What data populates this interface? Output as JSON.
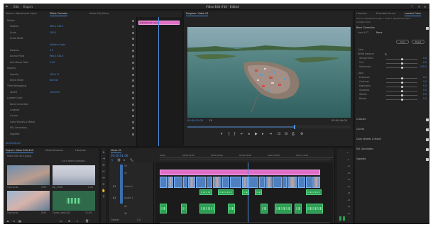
{
  "app": {
    "menu": [
      "Edit",
      "Export"
    ],
    "window_title": "Video Edit #10 - Edited"
  },
  "source_panel": {
    "tabs": [
      "Source: Adjustment Layer",
      "Effect Controls",
      "Audio Clip Mixer"
    ],
    "clip_label": "Adjustment Layer",
    "rows": [
      {
        "label": "Motion",
        "value": ""
      },
      {
        "label": "Position",
        "value": "960.0   540.0"
      },
      {
        "label": "Scale",
        "value": "100.0"
      },
      {
        "label": "Scale Width",
        "value": ""
      },
      {
        "label": "",
        "value": "Uniform Scale"
      },
      {
        "label": "Rotation",
        "value": "0.0"
      },
      {
        "label": "Anchor Point",
        "value": "960.0   540.0"
      },
      {
        "label": "Anti-flicker Filter",
        "value": "0.00"
      },
      {
        "label": "Opacity",
        "value": ""
      },
      {
        "label": "Opacity",
        "value": "100.0 %"
      },
      {
        "label": "Blend Mode",
        "value": "Normal"
      },
      {
        "label": "Time Remapping",
        "value": ""
      },
      {
        "label": "Speed",
        "value": "100.00%"
      },
      {
        "label": "Lumetri Color",
        "value": ""
      },
      {
        "label": "Basic Correction",
        "value": ""
      },
      {
        "label": "Creative",
        "value": ""
      },
      {
        "label": "Curves",
        "value": ""
      },
      {
        "label": "Color Wheels & Match",
        "value": ""
      },
      {
        "label": "HSL Secondary",
        "value": ""
      },
      {
        "label": "Vignette",
        "value": ""
      }
    ],
    "timecode": "00:00:00:00",
    "mini_clip_label": "Adjustment Layer"
  },
  "program_panel": {
    "tab": "Program: Video 01",
    "timecode": "00:00:01:00",
    "fit": "Fit",
    "duration": "00:00:44:00",
    "controls": [
      "marker",
      "in",
      "out",
      "go-in",
      "step-back",
      "play",
      "step-forward",
      "go-out",
      "insert",
      "overwrite",
      "export-frame",
      "camera",
      "more"
    ]
  },
  "lumetri_panel": {
    "tabs": [
      "Libraries",
      "Essential Sound",
      "Lumetri Color"
    ],
    "header": "Source: Adjustment Layer  >  Video 1 Adjustment Layer",
    "sub": "Lumetri Color",
    "section": "Basic Correction",
    "input_lut_label": "Input LUT",
    "input_lut_value": "None",
    "buttons": [
      "Auto",
      "Reset"
    ],
    "color_label": "Color",
    "white_balance": "White Balance",
    "temp_rows": [
      {
        "label": "Temperature",
        "value": "0.0",
        "pos": 0.5
      },
      {
        "label": "Tint",
        "value": "0.0",
        "pos": 0.5
      },
      {
        "label": "Saturation",
        "value": "100.0",
        "pos": 0.5
      }
    ],
    "light_label": "Light",
    "light_rows": [
      {
        "label": "Exposure",
        "value": "0.0",
        "pos": 0.5
      },
      {
        "label": "Contrast",
        "value": "0.0",
        "pos": 0.5
      },
      {
        "label": "Highlights",
        "value": "0.0",
        "pos": 0.5
      },
      {
        "label": "Shadows",
        "value": "0.0",
        "pos": 0.5
      },
      {
        "label": "Whites",
        "value": "0.0",
        "pos": 0.5
      },
      {
        "label": "Blacks",
        "value": "0.0",
        "pos": 0.5
      }
    ],
    "sections": [
      "Creative",
      "Curves",
      "Color Wheels & Match",
      "HSL Secondary",
      "Vignette"
    ]
  },
  "project_panel": {
    "tabs": [
      "Project: Video Edit #10",
      "Media Browser",
      "Libraries"
    ],
    "file": "Video Edit #10.prproj",
    "count": "1 of 6 items selected",
    "items": [
      {
        "name": "Overlords",
        "duration": "5:00"
      },
      {
        "name": "DJI_0398",
        "duration": "0:00"
      },
      {
        "name": "Overlords",
        "duration": "0:00"
      },
      {
        "name": "Ocean_edit_001",
        "duration": "21:09"
      }
    ]
  },
  "timeline": {
    "tab": "Video 01",
    "timecode": "00:00:01:00",
    "ruler": [
      "00:00",
      "00:00:15:00",
      "00:00:30:00",
      "00:00:45:00",
      "00:01:00:00",
      "00:01:15:00",
      "00:01:30:00"
    ],
    "video_tracks": [
      "V3",
      "V2",
      "V1"
    ],
    "audio_tracks": [
      "A1",
      "A2",
      "A3"
    ],
    "master": "Master",
    "master_value": "0.0",
    "track_labels": [
      "Video 1",
      "Audio 1",
      "Audio 2"
    ]
  },
  "meters": {
    "scale": [
      "0",
      "-6",
      "-12",
      "-18",
      "-24",
      "-30",
      "-36",
      "-42",
      "-48",
      "-54"
    ]
  },
  "colors": {
    "accent": "#4a8ee0",
    "adjustment": "#e06fc8",
    "video_clip": "#5c8dc9",
    "audio_clip": "#2e9e55"
  }
}
